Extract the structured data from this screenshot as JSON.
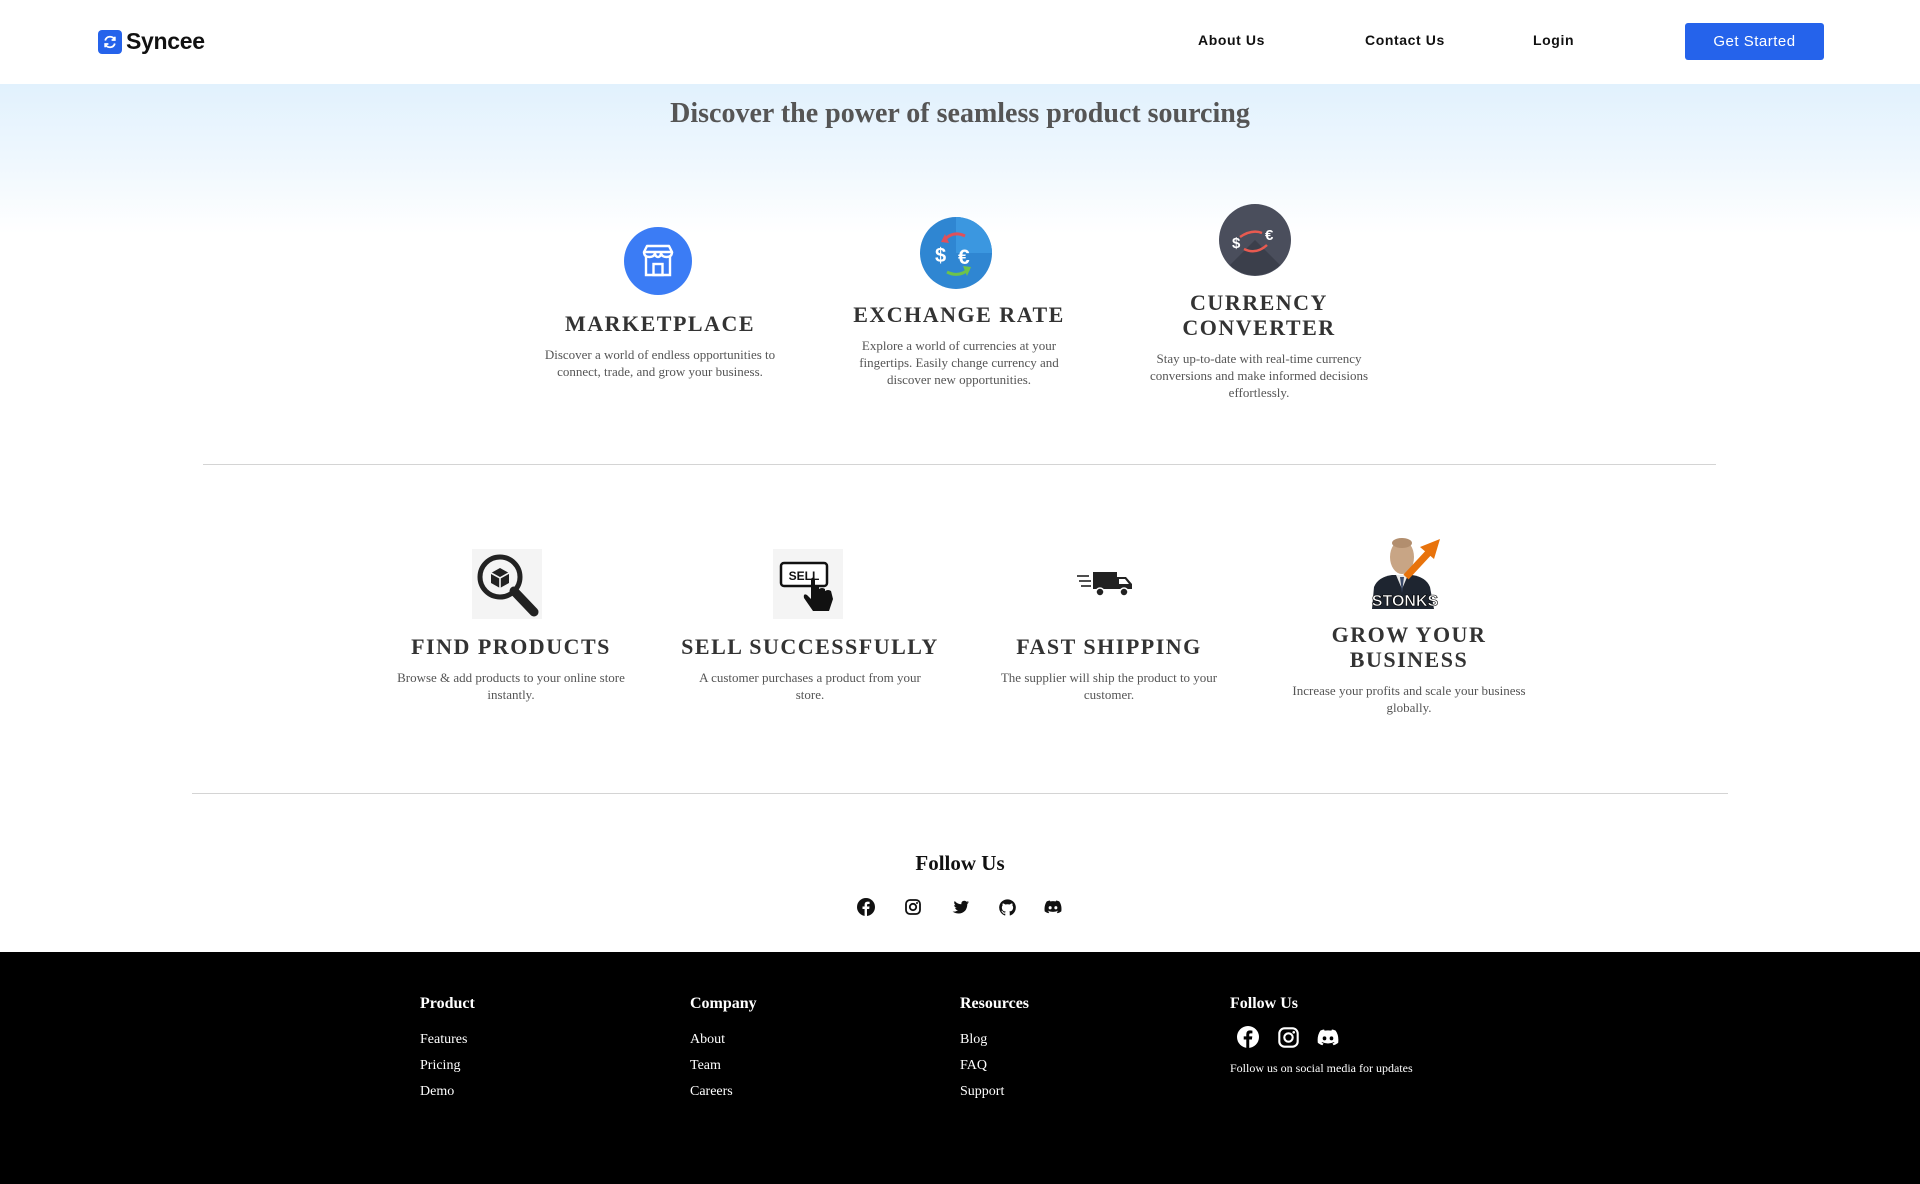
{
  "header": {
    "brand": "Syncee",
    "nav": [
      "About Us",
      "Contact Us",
      "Login"
    ],
    "cta": "Get Started"
  },
  "hero": {
    "title": "Discover the power of seamless product sourcing"
  },
  "features_top": [
    {
      "icon": "store-icon",
      "title": "MARKETPLACE",
      "text": [
        "Discover a world of endless opportunities to",
        "connect, trade, and grow your business."
      ]
    },
    {
      "icon": "exchange-icon",
      "title": "EXCHANGE RATE",
      "text": [
        "Explore a world of currencies at your",
        "fingertips. Easily change currency and",
        "discover new opportunities."
      ]
    },
    {
      "icon": "currency-converter-icon",
      "title_lines": [
        "CURRENCY",
        "CONVERTER"
      ],
      "text": [
        "Stay up-to-date with real-time currency",
        "conversions and make informed decisions",
        "effortlessly."
      ]
    }
  ],
  "features_bottom": [
    {
      "icon": "magnifier-box-icon",
      "title": "FIND PRODUCTS",
      "text": [
        "Browse & add products to your online store",
        "instantly."
      ]
    },
    {
      "icon": "sell-hand-icon",
      "icon_label": "SELL",
      "title": "SELL SUCCESSFULLY",
      "text": [
        "A customer purchases a product from your",
        "store."
      ]
    },
    {
      "icon": "delivery-truck-icon",
      "title": "FAST SHIPPING",
      "text": [
        "The supplier will ship the product to your",
        "customer."
      ]
    },
    {
      "icon": "stonks-meme-image",
      "icon_label": "STONKS",
      "title_lines": [
        "GROW YOUR",
        "BUSINESS"
      ],
      "text": [
        "Increase your profits and scale your business",
        "globally."
      ]
    }
  ],
  "follow": {
    "title": "Follow Us",
    "icons": [
      "facebook-icon",
      "instagram-icon",
      "twitter-icon",
      "github-icon",
      "discord-icon"
    ]
  },
  "footer": {
    "columns": [
      {
        "title": "Product",
        "links": [
          "Features",
          "Pricing",
          "Demo"
        ]
      },
      {
        "title": "Company",
        "links": [
          "About",
          "Team",
          "Careers"
        ]
      },
      {
        "title": "Resources",
        "links": [
          "Blog",
          "FAQ",
          "Support"
        ]
      }
    ],
    "follow_title": "Follow Us",
    "follow_icons": [
      "facebook-icon",
      "instagram-icon",
      "discord-icon"
    ],
    "follow_note": "Follow us on social media for updates"
  },
  "colors": {
    "accent": "#2563eb",
    "hero_gradient_top": "#e1f1fd",
    "footer_bg": "#000000",
    "stonks_arrow": "#e8730c"
  }
}
